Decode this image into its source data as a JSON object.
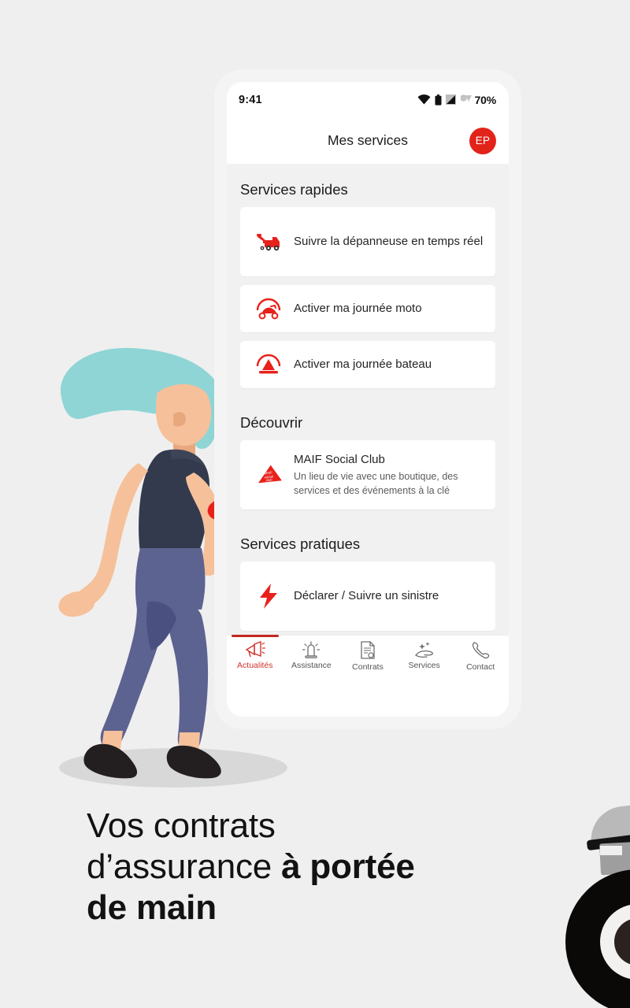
{
  "phone": {
    "status_bar": {
      "time": "9:41",
      "battery_percent": "70%",
      "icons": [
        "wifi-icon",
        "battery-icon",
        "cellular-signal-icon",
        "dropdown-triangle-icon"
      ]
    },
    "app_bar": {
      "title": "Mes services",
      "avatar_initials": "EP"
    },
    "sections": [
      {
        "title": "Services rapides",
        "items": [
          {
            "icon": "tow-truck-icon",
            "label": "Suivre la dépanneuse en temps réel",
            "sub": ""
          },
          {
            "icon": "motorcycle-icon",
            "label": "Activer ma journée moto",
            "sub": ""
          },
          {
            "icon": "sailboat-icon",
            "label": "Activer ma journée bateau",
            "sub": ""
          }
        ]
      },
      {
        "title": "Découvrir",
        "items": [
          {
            "icon": "maif-social-club-icon",
            "label": "MAIF Social Club",
            "sub": "Un lieu de vie avec une boutique, des services et des événements à la clé"
          }
        ]
      },
      {
        "title": "Services pratiques",
        "items": [
          {
            "icon": "lightning-bolt-icon",
            "label": "Déclarer / Suivre un sinistre",
            "sub": ""
          }
        ]
      }
    ],
    "bottom_nav": [
      {
        "icon": "megaphone-icon",
        "label": "Actualités",
        "active": true
      },
      {
        "icon": "siren-icon",
        "label": "Assistance",
        "active": false
      },
      {
        "icon": "document-seal-icon",
        "label": "Contrats",
        "active": false
      },
      {
        "icon": "hand-sparkle-icon",
        "label": "Services",
        "active": false
      },
      {
        "icon": "phone-icon",
        "label": "Contact",
        "active": false
      }
    ]
  },
  "headline": {
    "line1": "Vos contrats",
    "line2_normal": "d’assurance ",
    "line2_bold": "à portée",
    "line3_bold": "de main"
  },
  "colors": {
    "background": "#efefef",
    "brand_red": "#e2231a",
    "nav_active_red": "#d0342c",
    "card_white": "#ffffff",
    "screen_gray": "#f1f1f1",
    "hair_teal": "#8fd5d5",
    "top_navy": "#333a4d",
    "jeans_blue": "#5c6391",
    "skin": "#f6c09a"
  }
}
